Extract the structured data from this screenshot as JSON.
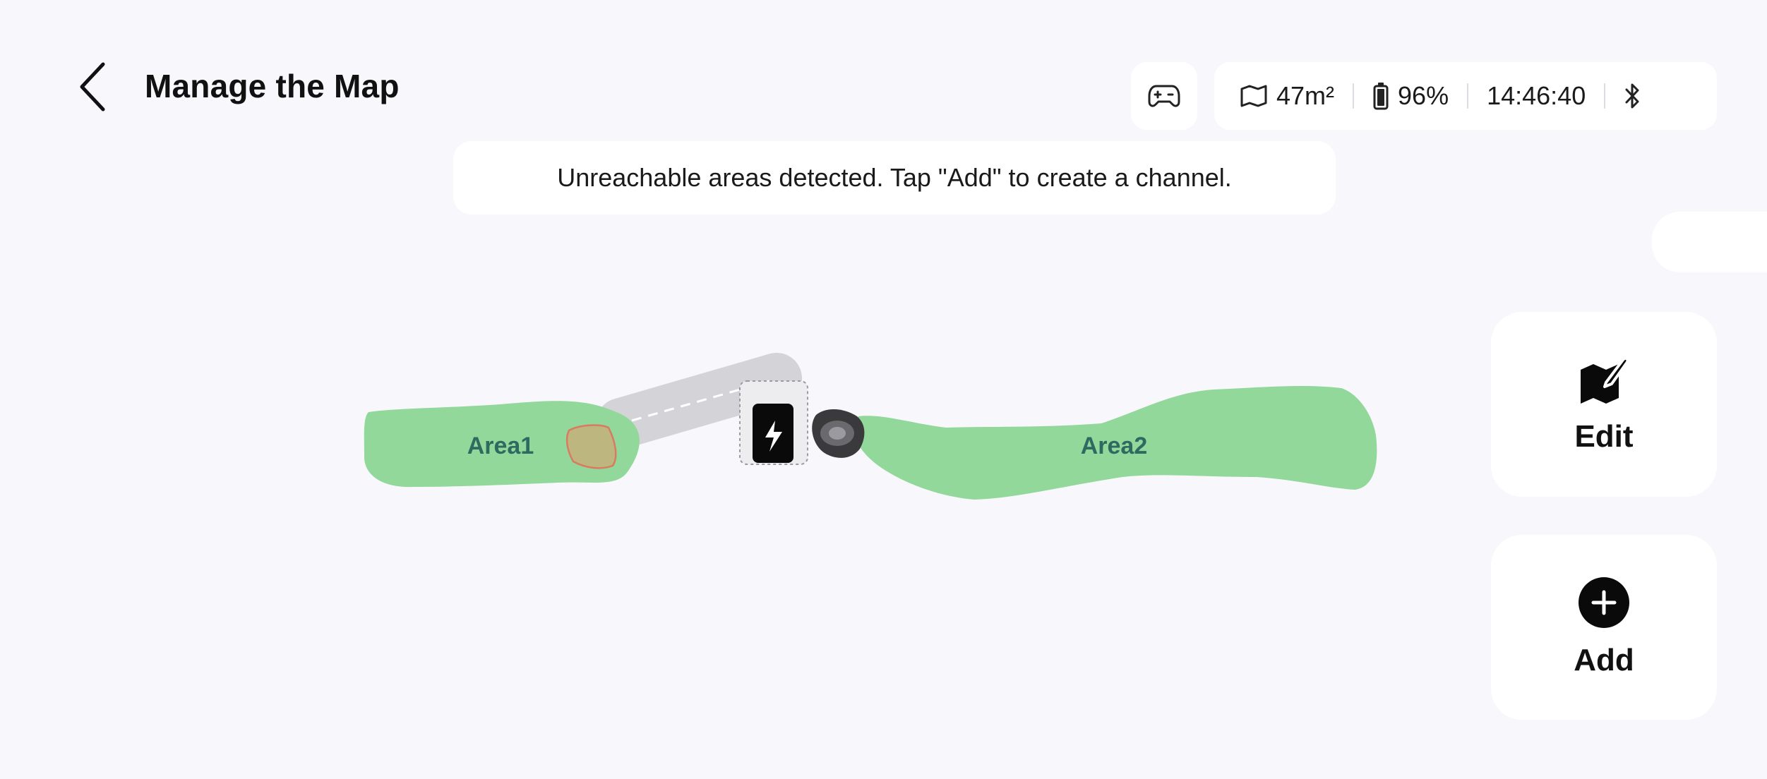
{
  "header": {
    "title": "Manage the Map"
  },
  "status": {
    "area": "47m²",
    "battery": "96%",
    "time": "14:46:40"
  },
  "banner": {
    "message": "Unreachable areas detected. Tap \"Add\" to create a channel."
  },
  "map": {
    "zones": [
      {
        "label": "Area1"
      },
      {
        "label": "Area2"
      }
    ]
  },
  "actions": {
    "edit_label": "Edit",
    "add_label": "Add"
  },
  "colors": {
    "background": "#f8f8fc",
    "zone_fill": "#92d89a",
    "zone_label": "#2f6a61",
    "exclusion_fill": "#e09a6a",
    "channel": "#d4d4d8",
    "card": "#ffffff"
  },
  "icons": {
    "back": "chevron-left-icon",
    "controller": "gamepad-icon",
    "area": "map-icon",
    "battery": "battery-icon",
    "bluetooth": "bluetooth-icon",
    "edit": "map-edit-icon",
    "add": "plus-circle-icon",
    "station": "charging-station-icon",
    "mower": "robot-mower-icon"
  }
}
